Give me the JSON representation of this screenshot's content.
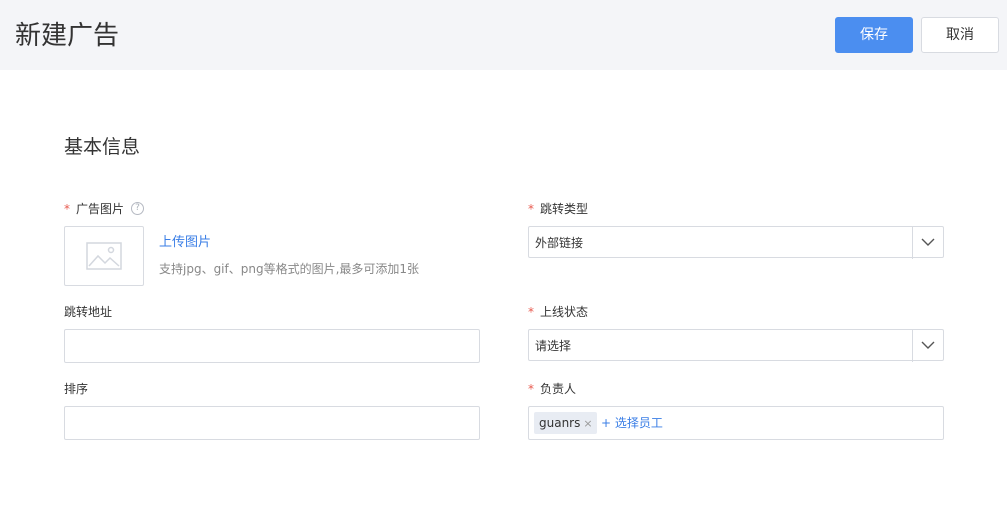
{
  "header": {
    "title": "新建广告",
    "save_label": "保存",
    "cancel_label": "取消"
  },
  "section": {
    "title": "基本信息"
  },
  "form": {
    "ad_image": {
      "label": "广告图片",
      "required": "*",
      "help_icon": "question-circle-icon",
      "upload_label": "上传图片",
      "hint": "支持jpg、gif、png等格式的图片,最多可添加1张"
    },
    "jump_type": {
      "label": "跳转类型",
      "required": "*",
      "value": "外部链接"
    },
    "jump_url": {
      "label": "跳转地址",
      "value": ""
    },
    "online_status": {
      "label": "上线状态",
      "required": "*",
      "value": "请选择"
    },
    "sort": {
      "label": "排序",
      "value": ""
    },
    "owner": {
      "label": "负责人",
      "required": "*",
      "tags": [
        "guanrs"
      ],
      "tag_remove": "×",
      "add_label": "+ 选择员工"
    }
  },
  "colors": {
    "primary": "#4b8ef0",
    "link": "#3a7ee6",
    "required": "#e85a4f",
    "header_bg": "#f4f5f8"
  }
}
